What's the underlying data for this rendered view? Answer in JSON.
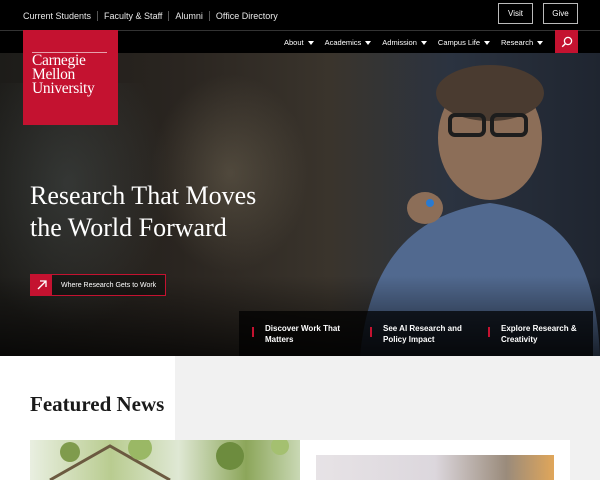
{
  "utility": {
    "links": [
      "Current Students",
      "Faculty & Staff",
      "Alumni",
      "Office Directory"
    ],
    "visit_label": "Visit",
    "give_label": "Give"
  },
  "logo": {
    "lines": [
      "Carnegie",
      "Mellon",
      "University"
    ]
  },
  "nav": {
    "items": [
      {
        "label": "About"
      },
      {
        "label": "Academics"
      },
      {
        "label": "Admission"
      },
      {
        "label": "Campus Life"
      },
      {
        "label": "Research"
      }
    ],
    "search_icon": "search-icon"
  },
  "hero": {
    "title_line1": "Research That Moves",
    "title_line2": "the World Forward",
    "cta_label": "Where Research Gets to Work",
    "links": [
      {
        "label": "Discover Work That Matters"
      },
      {
        "label": "See AI Research and Policy Impact"
      },
      {
        "label": "Explore Research & Creativity"
      }
    ]
  },
  "featured": {
    "title": "Featured News"
  },
  "colors": {
    "brand_red": "#c41230",
    "black": "#000000",
    "light_gray": "#f1f1f1"
  }
}
